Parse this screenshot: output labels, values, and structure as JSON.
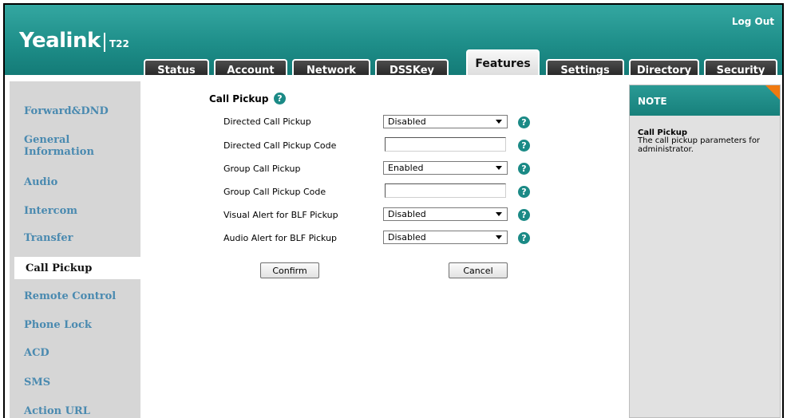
{
  "header": {
    "logo": "Yealink",
    "model": "T22",
    "logout": "Log Out"
  },
  "tabs": [
    {
      "label": "Status"
    },
    {
      "label": "Account"
    },
    {
      "label": "Network"
    },
    {
      "label": "DSSKey"
    },
    {
      "label": "Features",
      "active": true
    },
    {
      "label": "Settings"
    },
    {
      "label": "Directory"
    },
    {
      "label": "Security"
    }
  ],
  "sidebar": {
    "items": [
      {
        "label": "Forward&DND"
      },
      {
        "label": "General"
      },
      {
        "label": "Information"
      },
      {
        "label": "Audio"
      },
      {
        "label": "Intercom"
      },
      {
        "label": "Transfer"
      },
      {
        "label": "Call Pickup",
        "active": true
      },
      {
        "label": "Remote Control"
      },
      {
        "label": "Phone Lock"
      },
      {
        "label": "ACD"
      },
      {
        "label": "SMS"
      },
      {
        "label": "Action URL"
      }
    ]
  },
  "form": {
    "section_title": "Call Pickup",
    "rows": [
      {
        "label": "Directed Call Pickup",
        "type": "select",
        "value": "Disabled"
      },
      {
        "label": "Directed Call Pickup Code",
        "type": "input",
        "value": ""
      },
      {
        "label": "Group Call Pickup",
        "type": "select",
        "value": "Enabled"
      },
      {
        "label": "Group Call Pickup Code",
        "type": "input",
        "value": ""
      },
      {
        "label": "Visual Alert for BLF Pickup",
        "type": "select",
        "value": "Disabled"
      },
      {
        "label": "Audio Alert for BLF Pickup",
        "type": "select",
        "value": "Disabled"
      }
    ],
    "confirm_label": "Confirm",
    "cancel_label": "Cancel"
  },
  "note": {
    "heading": "NOTE",
    "title": "Call Pickup",
    "text": "The call pickup parameters for administrator."
  },
  "colors": {
    "header_teal": "#1e8e89",
    "sidebar_link": "#4a8ab0",
    "note_corner": "#f07a10"
  }
}
